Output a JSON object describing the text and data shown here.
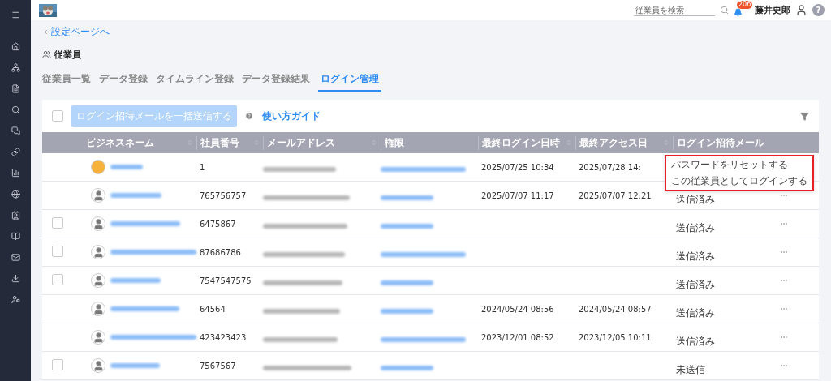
{
  "topbar": {
    "search": {
      "placeholder": "従業員を検索"
    },
    "notifications": "206",
    "user_name": "藤井史郎",
    "help": "?"
  },
  "breadcrumb": "設定ページへ",
  "page_title": "従業員",
  "tabs": [
    {
      "label": "従業員一覧",
      "selected": false
    },
    {
      "label": "データ登録",
      "selected": false
    },
    {
      "label": "タイムライン登録",
      "selected": false
    },
    {
      "label": "データ登録結果",
      "selected": false
    },
    {
      "label": "ログイン管理",
      "selected": true
    }
  ],
  "toolbar": {
    "select_all_checked": false,
    "bulk_button": {
      "label": "ログイン招待メールを一括送信する",
      "disabled": true
    },
    "guide_link": "使い方ガイド"
  },
  "table": {
    "columns": [
      {
        "label": "ビジネスネーム",
        "sortable": true
      },
      {
        "label": "社員番号",
        "sortable": true
      },
      {
        "label": "メールアドレス",
        "sortable": true
      },
      {
        "label": "権限",
        "sortable": false
      },
      {
        "label": "最終ログイン日時",
        "sortable": true
      },
      {
        "label": "最終アクセス日",
        "sortable": true
      },
      {
        "label": "ログイン招待メール",
        "sortable": false
      }
    ],
    "rows": [
      {
        "has_checkbox": false,
        "number": "1",
        "last_login": "2025/07/25 10:34",
        "last_access": "2025/07/28 14:",
        "invite": "",
        "menu_open": true
      },
      {
        "has_checkbox": false,
        "avatar": {
          "kind": "generic"
        },
        "number": "765756757",
        "last_login": "2025/07/07 11:17",
        "last_access": "2025/07/07 12:21",
        "invite": "送信済み",
        "menu_open": false
      },
      {
        "has_checkbox": true,
        "checked": false,
        "avatar": {
          "kind": "generic"
        },
        "number": "6475867",
        "last_login": "",
        "last_access": "",
        "invite": "送信済み",
        "menu_open": false
      },
      {
        "has_checkbox": true,
        "checked": false,
        "avatar": {
          "kind": "generic"
        },
        "number": "87686786",
        "last_login": "",
        "last_access": "",
        "invite": "送信済み",
        "menu_open": false
      },
      {
        "has_checkbox": true,
        "checked": false,
        "avatar": {
          "kind": "generic"
        },
        "number": "7547547575",
        "last_login": "",
        "last_access": "",
        "invite": "送信済み",
        "menu_open": false
      },
      {
        "has_checkbox": false,
        "avatar": {
          "kind": "generic"
        },
        "number": "64564",
        "last_login": "2024/05/24 08:56",
        "last_access": "2024/05/24 08:57",
        "invite": "送信済み",
        "menu_open": false
      },
      {
        "has_checkbox": false,
        "avatar": {
          "kind": "generic"
        },
        "number": "423423423",
        "last_login": "2023/12/01 08:52",
        "last_access": "2023/12/05 10:11",
        "invite": "送信済み",
        "menu_open": false
      },
      {
        "has_checkbox": true,
        "checked": false,
        "avatar": {
          "kind": "generic"
        },
        "number": "7567567",
        "last_login": "",
        "last_access": "",
        "invite": "未送信",
        "menu_open": false
      }
    ]
  },
  "row_menu": [
    "パスワードをリセットする",
    "この従業員としてログインする"
  ]
}
